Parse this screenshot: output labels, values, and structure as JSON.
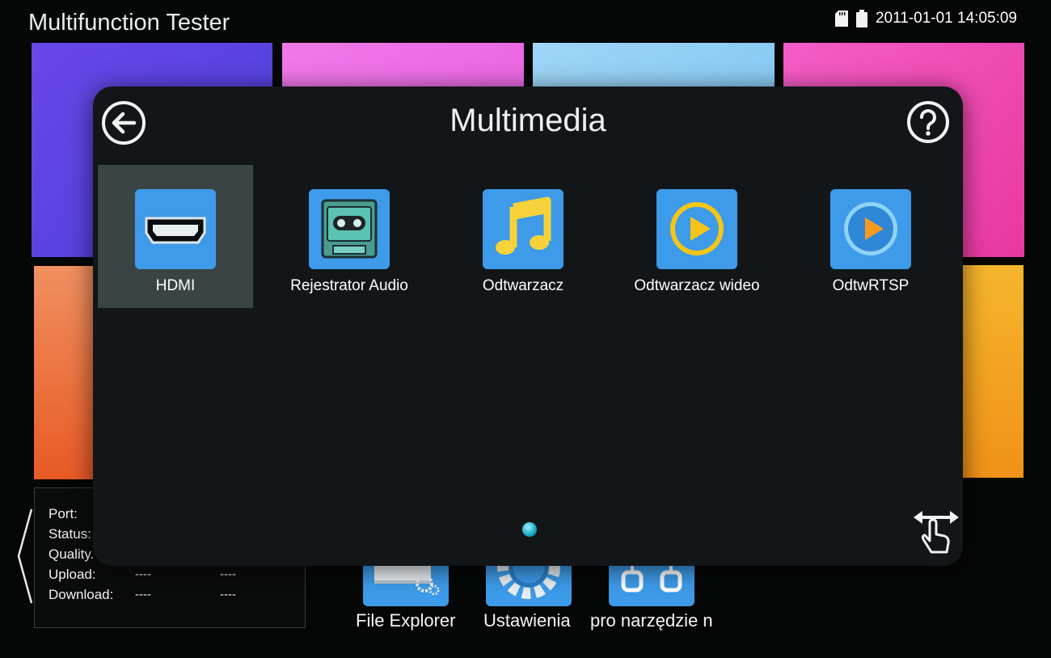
{
  "app": {
    "title": "Multifunction Tester"
  },
  "status_bar": {
    "datetime": "2011-01-01 14:05:09",
    "icons": [
      "sd-card-icon",
      "battery-icon"
    ]
  },
  "network_panel": {
    "rows": [
      {
        "label": "Port:"
      },
      {
        "label": "Status:"
      },
      {
        "label": "Quality."
      },
      {
        "label": "Upload:",
        "value1": "----",
        "value2": "----"
      },
      {
        "label": "Download:",
        "value1": "----",
        "value2": "----"
      }
    ]
  },
  "dock": {
    "items": [
      {
        "label": "File Explorer",
        "icon": "folder-gear-icon"
      },
      {
        "label": "Ustawienia",
        "icon": "gear-icon"
      },
      {
        "label": "pro narzędzie n",
        "icon": "tools-icon"
      }
    ]
  },
  "dialog": {
    "title": "Multimedia",
    "back_icon": "back-arrow-icon",
    "help_icon": "help-icon",
    "apps": [
      {
        "label": "HDMI",
        "icon": "hdmi-port-icon",
        "selected": true
      },
      {
        "label": "Rejestrator Audio",
        "icon": "cassette-recorder-icon"
      },
      {
        "label": "Odtwarzacz",
        "icon": "music-note-icon"
      },
      {
        "label": "Odtwarzacz wideo",
        "icon": "video-play-icon"
      },
      {
        "label": "OdtwRTSP",
        "icon": "rtsp-play-icon"
      }
    ],
    "page_indicator": {
      "current": 1,
      "total": 1
    },
    "gesture_icon": "swipe-hand-icon"
  },
  "colors": {
    "icon_blue": "#3d9be9",
    "dialog_bg": "#121619",
    "selected_bg": "#3b4444",
    "accent_cyan": "#19a6c1"
  }
}
